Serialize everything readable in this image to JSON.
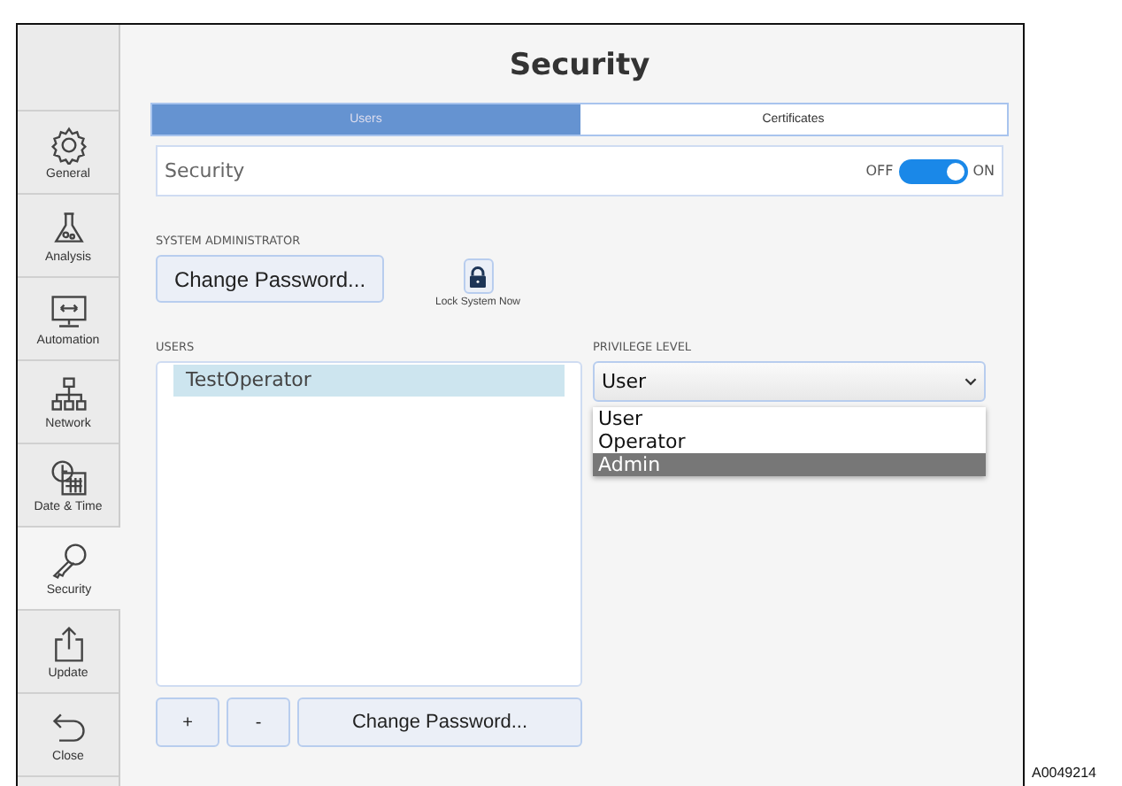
{
  "window": {
    "title": "Security"
  },
  "sidebar": {
    "items": [
      {
        "kind": "gear",
        "label": "General",
        "selected": false
      },
      {
        "kind": "flask",
        "label": "Analysis",
        "selected": false
      },
      {
        "kind": "monitor",
        "label": "Automation",
        "selected": false
      },
      {
        "kind": "network",
        "label": "Network",
        "selected": false
      },
      {
        "kind": "clock",
        "label": "Date & Time",
        "selected": false
      },
      {
        "kind": "key",
        "label": "Security",
        "selected": true
      },
      {
        "kind": "upload",
        "label": "Update",
        "selected": false
      },
      {
        "kind": "back",
        "label": "Close",
        "selected": false
      }
    ]
  },
  "tabs": [
    {
      "label": "Users",
      "selected": true
    },
    {
      "label": "Certificates",
      "selected": false
    }
  ],
  "security": {
    "label": "Security",
    "off_label": "OFF",
    "on_label": "ON",
    "on": true
  },
  "system_administrator": {
    "heading": "SYSTEM ADMINISTRATOR",
    "button": "Change Password...",
    "lock_label": "Lock System Now"
  },
  "users": {
    "heading": "USERS",
    "items": [
      {
        "name": "TestOperator",
        "selected": true
      }
    ],
    "add": "+",
    "remove": "-",
    "change": "Change Password..."
  },
  "privilege": {
    "heading": "PRIVILEGE LEVEL",
    "value": "User",
    "options": [
      {
        "label": "User",
        "highlighted": false
      },
      {
        "label": "Operator",
        "highlighted": false
      },
      {
        "label": "Admin",
        "highlighted": true
      }
    ]
  },
  "figure_id": "A0049214"
}
